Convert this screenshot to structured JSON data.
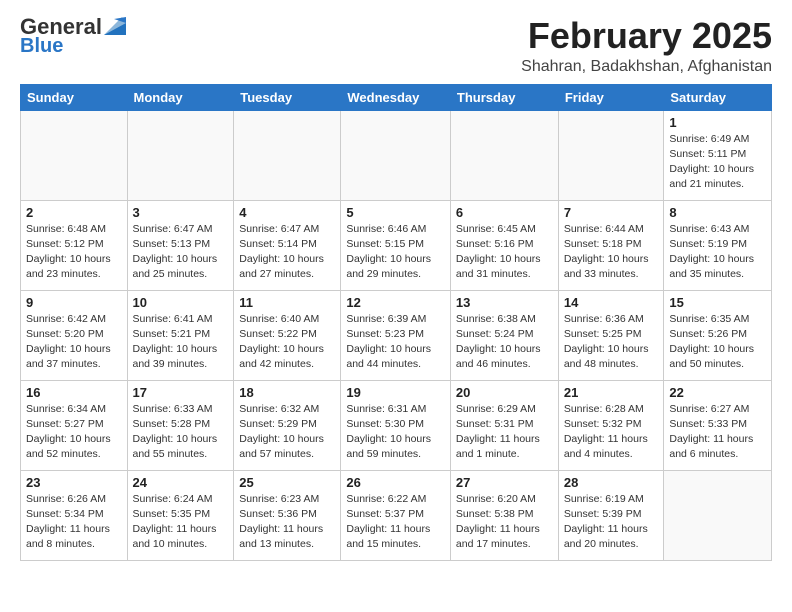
{
  "header": {
    "logo_general": "General",
    "logo_blue": "Blue",
    "month_title": "February 2025",
    "location": "Shahran, Badakhshan, Afghanistan"
  },
  "weekdays": [
    "Sunday",
    "Monday",
    "Tuesday",
    "Wednesday",
    "Thursday",
    "Friday",
    "Saturday"
  ],
  "weeks": [
    [
      {
        "day": "",
        "info": ""
      },
      {
        "day": "",
        "info": ""
      },
      {
        "day": "",
        "info": ""
      },
      {
        "day": "",
        "info": ""
      },
      {
        "day": "",
        "info": ""
      },
      {
        "day": "",
        "info": ""
      },
      {
        "day": "1",
        "info": "Sunrise: 6:49 AM\nSunset: 5:11 PM\nDaylight: 10 hours and 21 minutes."
      }
    ],
    [
      {
        "day": "2",
        "info": "Sunrise: 6:48 AM\nSunset: 5:12 PM\nDaylight: 10 hours and 23 minutes."
      },
      {
        "day": "3",
        "info": "Sunrise: 6:47 AM\nSunset: 5:13 PM\nDaylight: 10 hours and 25 minutes."
      },
      {
        "day": "4",
        "info": "Sunrise: 6:47 AM\nSunset: 5:14 PM\nDaylight: 10 hours and 27 minutes."
      },
      {
        "day": "5",
        "info": "Sunrise: 6:46 AM\nSunset: 5:15 PM\nDaylight: 10 hours and 29 minutes."
      },
      {
        "day": "6",
        "info": "Sunrise: 6:45 AM\nSunset: 5:16 PM\nDaylight: 10 hours and 31 minutes."
      },
      {
        "day": "7",
        "info": "Sunrise: 6:44 AM\nSunset: 5:18 PM\nDaylight: 10 hours and 33 minutes."
      },
      {
        "day": "8",
        "info": "Sunrise: 6:43 AM\nSunset: 5:19 PM\nDaylight: 10 hours and 35 minutes."
      }
    ],
    [
      {
        "day": "9",
        "info": "Sunrise: 6:42 AM\nSunset: 5:20 PM\nDaylight: 10 hours and 37 minutes."
      },
      {
        "day": "10",
        "info": "Sunrise: 6:41 AM\nSunset: 5:21 PM\nDaylight: 10 hours and 39 minutes."
      },
      {
        "day": "11",
        "info": "Sunrise: 6:40 AM\nSunset: 5:22 PM\nDaylight: 10 hours and 42 minutes."
      },
      {
        "day": "12",
        "info": "Sunrise: 6:39 AM\nSunset: 5:23 PM\nDaylight: 10 hours and 44 minutes."
      },
      {
        "day": "13",
        "info": "Sunrise: 6:38 AM\nSunset: 5:24 PM\nDaylight: 10 hours and 46 minutes."
      },
      {
        "day": "14",
        "info": "Sunrise: 6:36 AM\nSunset: 5:25 PM\nDaylight: 10 hours and 48 minutes."
      },
      {
        "day": "15",
        "info": "Sunrise: 6:35 AM\nSunset: 5:26 PM\nDaylight: 10 hours and 50 minutes."
      }
    ],
    [
      {
        "day": "16",
        "info": "Sunrise: 6:34 AM\nSunset: 5:27 PM\nDaylight: 10 hours and 52 minutes."
      },
      {
        "day": "17",
        "info": "Sunrise: 6:33 AM\nSunset: 5:28 PM\nDaylight: 10 hours and 55 minutes."
      },
      {
        "day": "18",
        "info": "Sunrise: 6:32 AM\nSunset: 5:29 PM\nDaylight: 10 hours and 57 minutes."
      },
      {
        "day": "19",
        "info": "Sunrise: 6:31 AM\nSunset: 5:30 PM\nDaylight: 10 hours and 59 minutes."
      },
      {
        "day": "20",
        "info": "Sunrise: 6:29 AM\nSunset: 5:31 PM\nDaylight: 11 hours and 1 minute."
      },
      {
        "day": "21",
        "info": "Sunrise: 6:28 AM\nSunset: 5:32 PM\nDaylight: 11 hours and 4 minutes."
      },
      {
        "day": "22",
        "info": "Sunrise: 6:27 AM\nSunset: 5:33 PM\nDaylight: 11 hours and 6 minutes."
      }
    ],
    [
      {
        "day": "23",
        "info": "Sunrise: 6:26 AM\nSunset: 5:34 PM\nDaylight: 11 hours and 8 minutes."
      },
      {
        "day": "24",
        "info": "Sunrise: 6:24 AM\nSunset: 5:35 PM\nDaylight: 11 hours and 10 minutes."
      },
      {
        "day": "25",
        "info": "Sunrise: 6:23 AM\nSunset: 5:36 PM\nDaylight: 11 hours and 13 minutes."
      },
      {
        "day": "26",
        "info": "Sunrise: 6:22 AM\nSunset: 5:37 PM\nDaylight: 11 hours and 15 minutes."
      },
      {
        "day": "27",
        "info": "Sunrise: 6:20 AM\nSunset: 5:38 PM\nDaylight: 11 hours and 17 minutes."
      },
      {
        "day": "28",
        "info": "Sunrise: 6:19 AM\nSunset: 5:39 PM\nDaylight: 11 hours and 20 minutes."
      },
      {
        "day": "",
        "info": ""
      }
    ]
  ]
}
